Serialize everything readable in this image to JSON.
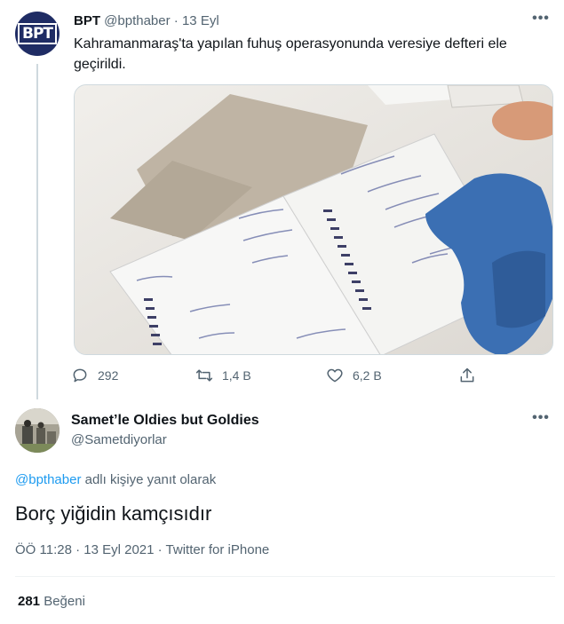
{
  "tweet": {
    "author_name": "BPT",
    "author_handle": "@bpthaber",
    "separator": "·",
    "date": "13 Eyl",
    "avatar_text": "BPT",
    "text": "Kahramanmaraş'ta yapılan fuhuş operasyonunda veresiye defteri ele geçirildi.",
    "media_icon": "photo-notebook",
    "actions": {
      "replies": "292",
      "retweets": "1,4 B",
      "likes": "6,2 B"
    }
  },
  "reply": {
    "author_name": "Samet’le Oldies but Goldies",
    "author_handle": "@Sametdiyorlar",
    "replying_to_mention": "@bpthaber",
    "replying_to_suffix": " adlı kişiye yanıt olarak",
    "text": "Borç yiğidin kamçısıdır",
    "timestamp": "ÖÖ 11:28 · 13 Eyl 2021 · Twitter for iPhone",
    "like_count": "281",
    "like_label": "Beğeni"
  },
  "icons": {
    "more": "more-icon",
    "reply": "reply-icon",
    "retweet": "retweet-icon",
    "like": "heart-icon",
    "share": "share-icon"
  },
  "colors": {
    "text": "#0f1419",
    "secondary": "#536471",
    "accent": "#1d9bf0",
    "thread_line": "#cfd9de"
  }
}
